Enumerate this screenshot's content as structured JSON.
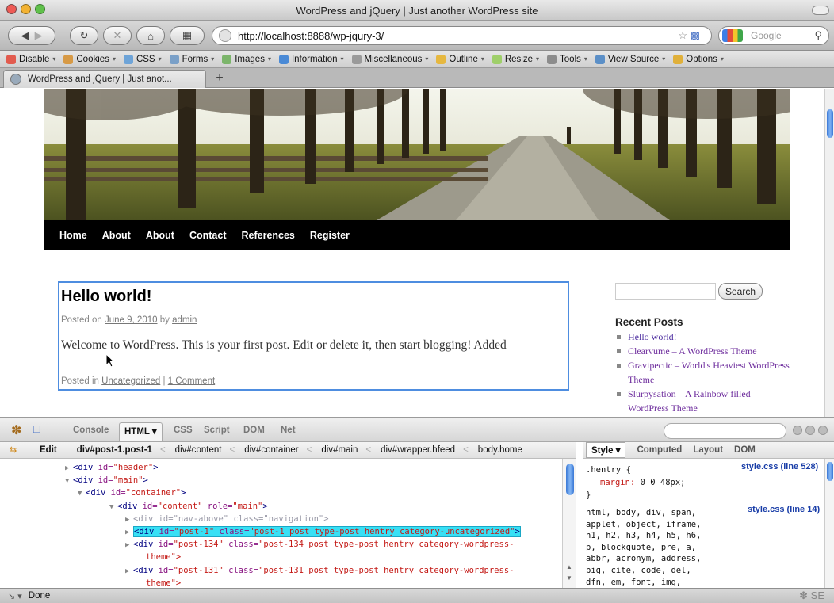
{
  "window": {
    "title": "WordPress and jQuery | Just another WordPress site"
  },
  "navbar": {
    "url": "http://localhost:8888/wp-jqury-3/",
    "search_placeholder": "Google"
  },
  "webdev_toolbar": {
    "items": [
      {
        "label": "Disable",
        "icon": "no-entry-icon",
        "color": "#e25b4e"
      },
      {
        "label": "Cookies",
        "icon": "cookie-icon",
        "color": "#d79a46"
      },
      {
        "label": "CSS",
        "icon": "css-icon",
        "color": "#6ea4d8"
      },
      {
        "label": "Forms",
        "icon": "forms-icon",
        "color": "#7aa0c8"
      },
      {
        "label": "Images",
        "icon": "images-icon",
        "color": "#7cb56b"
      },
      {
        "label": "Information",
        "icon": "info-icon",
        "color": "#4a8ad6"
      },
      {
        "label": "Miscellaneous",
        "icon": "misc-icon",
        "color": "#9a9a9a"
      },
      {
        "label": "Outline",
        "icon": "pencil-icon",
        "color": "#e6b840"
      },
      {
        "label": "Resize",
        "icon": "resize-icon",
        "color": "#9fcf6a"
      },
      {
        "label": "Tools",
        "icon": "wrench-icon",
        "color": "#8c8c8c"
      },
      {
        "label": "View Source",
        "icon": "source-icon",
        "color": "#5b8fc7"
      },
      {
        "label": "Options",
        "icon": "key-icon",
        "color": "#e0b03a"
      }
    ]
  },
  "tabs": [
    {
      "label": "WordPress and jQuery | Just anot..."
    }
  ],
  "site": {
    "menu": [
      "Home",
      "About",
      "About",
      "Contact",
      "References",
      "Register"
    ],
    "post": {
      "title": "Hello world!",
      "meta_prefix": "Posted on",
      "date": "June 9, 2010",
      "meta_by": "by",
      "author": "admin",
      "content": "Welcome to WordPress. This is your first post. Edit or delete it, then start blogging! Added",
      "util_prefix": "Posted in",
      "category": "Uncategorized",
      "util_sep": "|",
      "comments": "1 Comment"
    },
    "sidebar": {
      "search_button": "Search",
      "recent_title": "Recent Posts",
      "recent_posts": [
        "Hello world!",
        "Clearvume – A WordPress Theme",
        "Gravipectic – World's Heaviest WordPress Theme",
        "Slurpysation – A Rainbow filled WordPress Theme"
      ]
    }
  },
  "firebug": {
    "tabs": [
      "Console",
      "HTML",
      "CSS",
      "Script",
      "DOM",
      "Net"
    ],
    "active_tab": "HTML",
    "edit_label": "Edit",
    "breadcrumbs": [
      "div#post-1.post-1",
      "div#content",
      "div#container",
      "div#main",
      "div#wrapper.hfeed",
      "body.home"
    ],
    "side_tabs": [
      "Style",
      "Computed",
      "Layout",
      "DOM"
    ],
    "html_lines": [
      {
        "tag_open": "<div ",
        "attr": "id=",
        "val": "\"header\"",
        "tag_close": ">"
      },
      {
        "tag_open": "<div ",
        "attr": "id=",
        "val": "\"main\"",
        "tag_close": ">"
      },
      {
        "tag_open": "<div ",
        "attr": "id=",
        "val": "\"container\"",
        "tag_close": ">"
      },
      {
        "tag_open": "<div ",
        "attr": "id=",
        "val": "\"content\"",
        "attr2": " role=",
        "val2": "\"main\"",
        "tag_close": ">"
      },
      {
        "tag_open": "<div ",
        "attr": "id=",
        "val": "\"nav-above\"",
        "attr2": " class=",
        "val2": "\"navigation\"",
        "tag_close": ">"
      },
      {
        "tag_open": "<div ",
        "attr": "id=",
        "val": "\"post-1\"",
        "attr2": " class=",
        "val2": "\"post-1 post type-post hentry category-uncategorized\"",
        "tag_close": ">"
      },
      {
        "tag_open": "<div ",
        "attr": "id=",
        "val": "\"post-134\"",
        "attr2": " class=",
        "val2": "\"post-134 post type-post hentry category-wordpress-",
        "tag_close": ""
      },
      {
        "text": "theme\">"
      },
      {
        "tag_open": "<div ",
        "attr": "id=",
        "val": "\"post-131\"",
        "attr2": " class=",
        "val2": "\"post-131 post type-post hentry category-wordpress-",
        "tag_close": ""
      },
      {
        "text": "theme\">"
      }
    ],
    "style": {
      "rule1_selector": ".hentry {",
      "rule1_decl_prop": "margin:",
      "rule1_decl_val": " 0 0 48px;",
      "rule1_close": "}",
      "rule1_source": "style.css (line 528)",
      "rule2_lines": [
        "html, body, div, span,",
        "applet, object, iframe,",
        "h1, h2, h3, h4, h5, h6,",
        "p, blockquote, pre, a,",
        "abbr, acronym, address,",
        "big, cite, code, del,",
        "dfn, em, font, img,"
      ],
      "rule2_source": "style.css (line 14)"
    }
  },
  "status": {
    "text": "Done"
  }
}
